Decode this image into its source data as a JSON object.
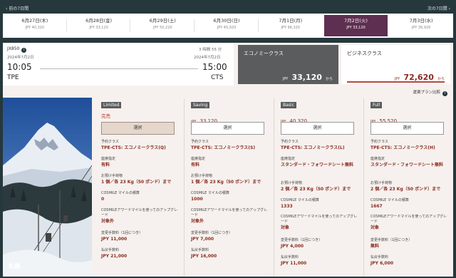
{
  "nav": {
    "prev_label": "前の7日間",
    "next_label": "次の7日間"
  },
  "dates": [
    {
      "date": "6月27日(木)",
      "price": "JPY 40,320",
      "selected": false
    },
    {
      "date": "6月28日(金)",
      "price": "JPY 33,120",
      "selected": false
    },
    {
      "date": "6月29日(土)",
      "price": "JPY 50,220",
      "selected": false
    },
    {
      "date": "6月30日(日)",
      "price": "JPY 45,020",
      "selected": false
    },
    {
      "date": "7月1日(月)",
      "price": "JPY 96,320",
      "selected": false
    },
    {
      "date": "7月2日(火)",
      "price": "JPY 33,120",
      "selected": true
    },
    {
      "date": "7月3日(水)",
      "price": "JPY 36,920",
      "selected": false
    }
  ],
  "flight": {
    "number": "JX850",
    "duration": "3 時間 55 分",
    "depart_date": "2024年7月2日",
    "arrive_date": "2024年7月2日",
    "depart_time": "10:05",
    "arrive_time": "15:00",
    "depart_code": "TPE",
    "arrive_code": "CTS"
  },
  "cabins": {
    "economy": {
      "name": "エコノミークラス",
      "currency": "JPY",
      "amount": "33,120",
      "suffix": "から"
    },
    "business": {
      "name": "ビジネスクラス",
      "currency": "JPY",
      "amount": "72,620",
      "suffix": "から"
    }
  },
  "compare_label": "運賃プラン比較",
  "photo_label": "札幌",
  "colors": {
    "brand": "#26383c",
    "selected": "#5e2f50",
    "accent": "#8a2a20",
    "cabin_active": "#5a5c5e"
  },
  "labels": {
    "select": "選択",
    "booking_class": "予約クラス",
    "seat": "座席指定",
    "baggage": "お預け手荷物",
    "miles": "COSMILE マイルの積算",
    "upgrade": "COSMILEアワードマイルを使ってのアップグレード",
    "change_fee": "変更手数料（1回につき）",
    "refund_fee": "払戻手数料"
  },
  "fares": [
    {
      "tag": "Limited",
      "status": "完売",
      "currency": "",
      "price": "",
      "booking_class": "TPE-CTS: エコノミークラス(Q)",
      "seat": "有料",
      "baggage": "1 個／各 23 Kg（50 ポンド）まで",
      "miles": "0",
      "upgrade": "対象外",
      "change_fee": "JPY 11,000",
      "refund_fee": "JPY 21,000"
    },
    {
      "tag": "Saving",
      "status": "",
      "currency": "JPY",
      "price": "33,120",
      "booking_class": "TPE-CTS: エコノミークラス(S)",
      "seat": "有料",
      "baggage": "1 個／各 23 Kg（50 ポンド）まで",
      "miles": "1000",
      "upgrade": "対象外",
      "change_fee": "JPY 7,000",
      "refund_fee": "JPY 16,000"
    },
    {
      "tag": "Basic",
      "status": "",
      "currency": "JPY",
      "price": "40,320",
      "booking_class": "TPE-CTS: エコノミークラス(L)",
      "seat": "スタンダード・フォワードシート無料",
      "baggage": "2 個／各 23 Kg（50 ポンド）まで",
      "miles": "1333",
      "upgrade": "対象",
      "change_fee": "JPY 4,000",
      "refund_fee": "JPY 11,000"
    },
    {
      "tag": "Full",
      "status": "",
      "currency": "JPY",
      "price": "55,520",
      "booking_class": "TPE-CTS: エコノミークラス(H)",
      "seat": "スタンダード・フォワードシート無料",
      "baggage": "2 個／各 23 Kg（50 ポンド）まで",
      "miles": "1667",
      "upgrade": "対象",
      "change_fee": "無料",
      "refund_fee": "JPY 6,000"
    }
  ]
}
